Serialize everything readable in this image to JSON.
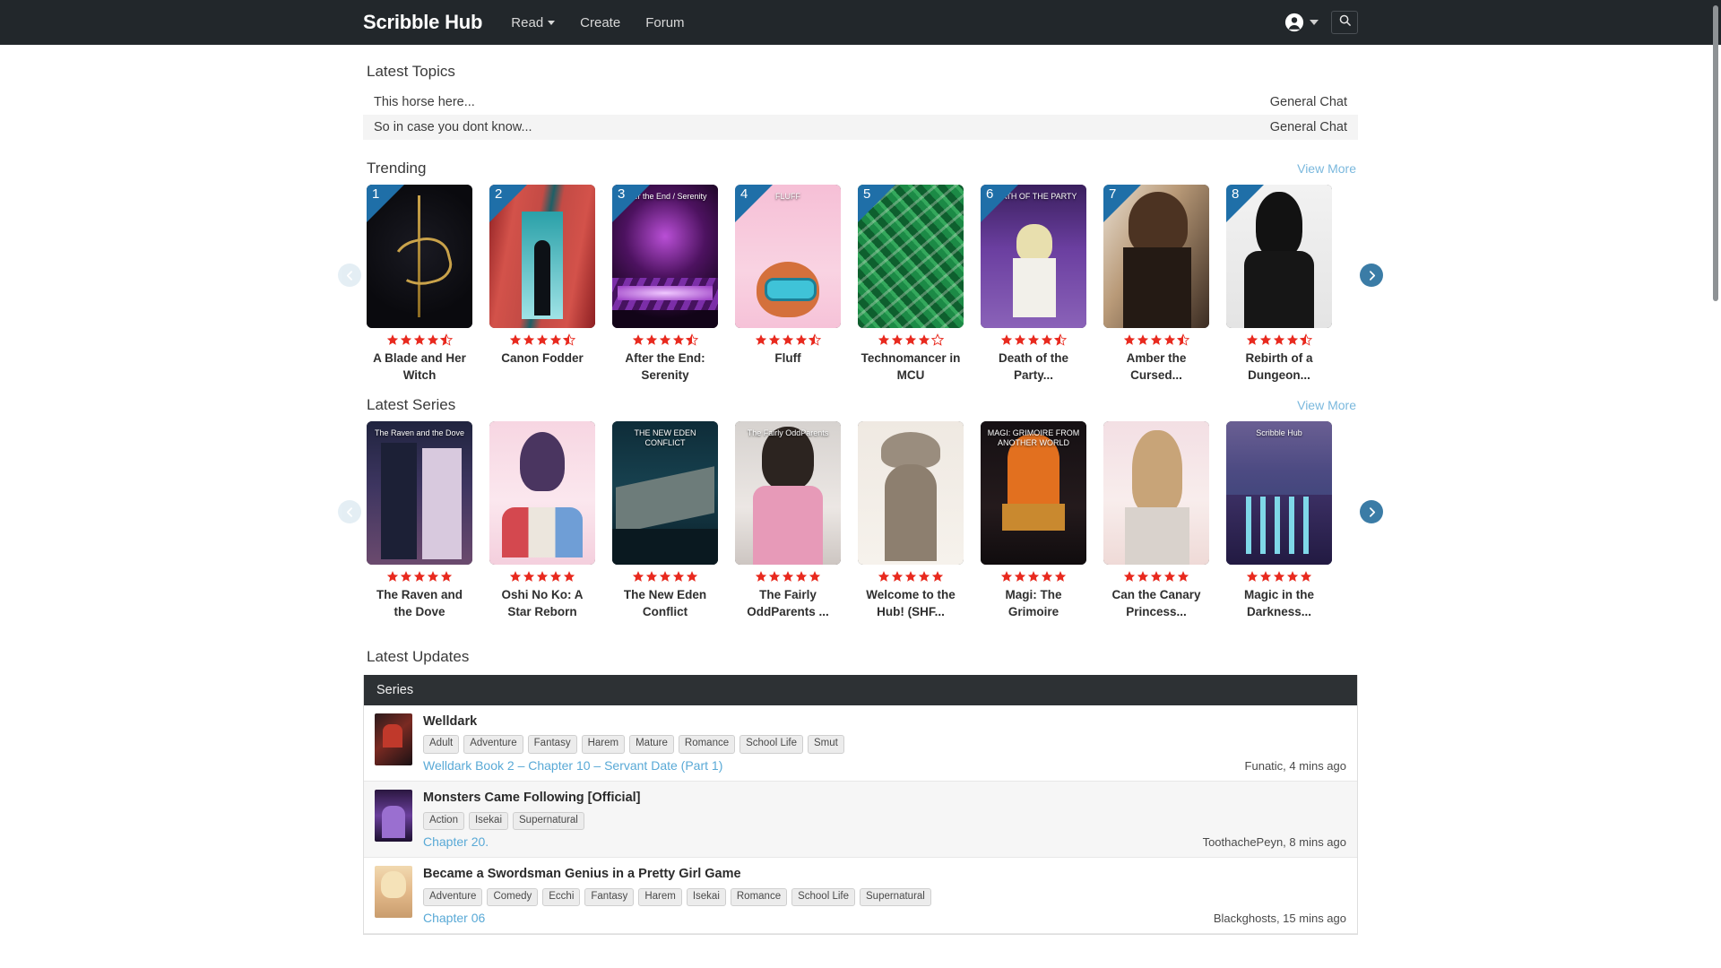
{
  "header": {
    "brand": "Scribble Hub",
    "nav": [
      {
        "label": "Read",
        "has_caret": true
      },
      {
        "label": "Create",
        "has_caret": false
      },
      {
        "label": "Forum",
        "has_caret": false
      }
    ],
    "account_icon": "account-circle-icon",
    "search_icon": "search-icon"
  },
  "latest_topics": {
    "title": "Latest Topics",
    "rows": [
      {
        "topic": "This horse here...",
        "category": "General Chat"
      },
      {
        "topic": "So in case you dont know...",
        "category": "General Chat"
      }
    ]
  },
  "trending": {
    "title": "Trending",
    "view_more": "View More",
    "prev_icon": "chevron-left-icon",
    "next_icon": "chevron-right-icon",
    "cards": [
      {
        "rank": "1",
        "title": "A Blade and Her Witch",
        "rating": 4.5,
        "art": "a-blade",
        "art_label": ""
      },
      {
        "rank": "2",
        "title": "Canon Fodder",
        "rating": 4.5,
        "art": "a-canon",
        "art_label": ""
      },
      {
        "rank": "3",
        "title": "After the End: Serenity",
        "rating": 4.5,
        "art": "a-after",
        "art_label": "After the End / Serenity"
      },
      {
        "rank": "4",
        "title": "Fluff",
        "rating": 4.5,
        "art": "a-fluff",
        "art_label": "FLUFF"
      },
      {
        "rank": "5",
        "title": "Technomancer in MCU",
        "rating": 4.0,
        "art": "a-techno",
        "art_label": ""
      },
      {
        "rank": "6",
        "title": "Death of the Party...",
        "rating": 4.5,
        "art": "a-death",
        "art_label": "DEATH OF THE PARTY"
      },
      {
        "rank": "7",
        "title": "Amber the Cursed...",
        "rating": 4.5,
        "art": "a-amber",
        "art_label": ""
      },
      {
        "rank": "8",
        "title": "Rebirth of a Dungeon...",
        "rating": 4.5,
        "art": "a-rebirth",
        "art_label": ""
      }
    ]
  },
  "latest_series": {
    "title": "Latest Series",
    "view_more": "View More",
    "prev_icon": "chevron-left-icon",
    "next_icon": "chevron-right-icon",
    "cards": [
      {
        "rank": "",
        "title": "The Raven and the Dove",
        "rating": 5,
        "art": "a-raven",
        "art_label": "The Raven and the Dove"
      },
      {
        "rank": "",
        "title": "Oshi No Ko: A Star Reborn",
        "rating": 5,
        "art": "a-oshi",
        "art_label": ""
      },
      {
        "rank": "",
        "title": "The New Eden Conflict",
        "rating": 5,
        "art": "a-eden",
        "art_label": "THE NEW EDEN CONFLICT"
      },
      {
        "rank": "",
        "title": "The Fairly OddParents ...",
        "rating": 5,
        "art": "a-fairly",
        "art_label": "The Fairly OddParents"
      },
      {
        "rank": "",
        "title": "Welcome to the Hub! (SHF...",
        "rating": 5,
        "art": "a-welcome",
        "art_label": ""
      },
      {
        "rank": "",
        "title": "Magi: The Grimoire",
        "rating": 5,
        "art": "a-magi",
        "art_label": "MAGI: GRIMOIRE FROM ANOTHER WORLD"
      },
      {
        "rank": "",
        "title": "Can the Canary Princess...",
        "rating": 5,
        "art": "a-canary",
        "art_label": ""
      },
      {
        "rank": "",
        "title": "Magic in the Darkness...",
        "rating": 5,
        "art": "a-magic",
        "art_label": "Scribble Hub"
      }
    ]
  },
  "latest_updates": {
    "title": "Latest Updates",
    "column_header": "Series",
    "rows": [
      {
        "series": "Welldark",
        "thumb": "t-welldark",
        "tags": [
          "Adult",
          "Adventure",
          "Fantasy",
          "Harem",
          "Mature",
          "Romance",
          "School Life",
          "Smut"
        ],
        "chapter": "Welldark Book 2 – Chapter 10 – Servant Date (Part 1)",
        "meta": "Funatic, 4 mins ago"
      },
      {
        "series": "Monsters Came Following [Official]",
        "thumb": "t-monsters",
        "tags": [
          "Action",
          "Isekai",
          "Supernatural"
        ],
        "chapter": "Chapter 20.",
        "meta": "ToothachePeyn, 8 mins ago"
      },
      {
        "series": "Became a Swordsman Genius in a Pretty Girl Game",
        "thumb": "t-swordsman",
        "tags": [
          "Adventure",
          "Comedy",
          "Ecchi",
          "Fantasy",
          "Harem",
          "Isekai",
          "Romance",
          "School Life",
          "Supernatural"
        ],
        "chapter": "Chapter 06",
        "meta": "Blackghosts, 15 mins ago"
      }
    ]
  },
  "colors": {
    "navbar": "#22272b",
    "rank_badge": "#1f6fa8",
    "star": "#e8291e",
    "link": "#59a9d6",
    "view_more": "#7ab8dd",
    "table_header": "#2d3134"
  }
}
